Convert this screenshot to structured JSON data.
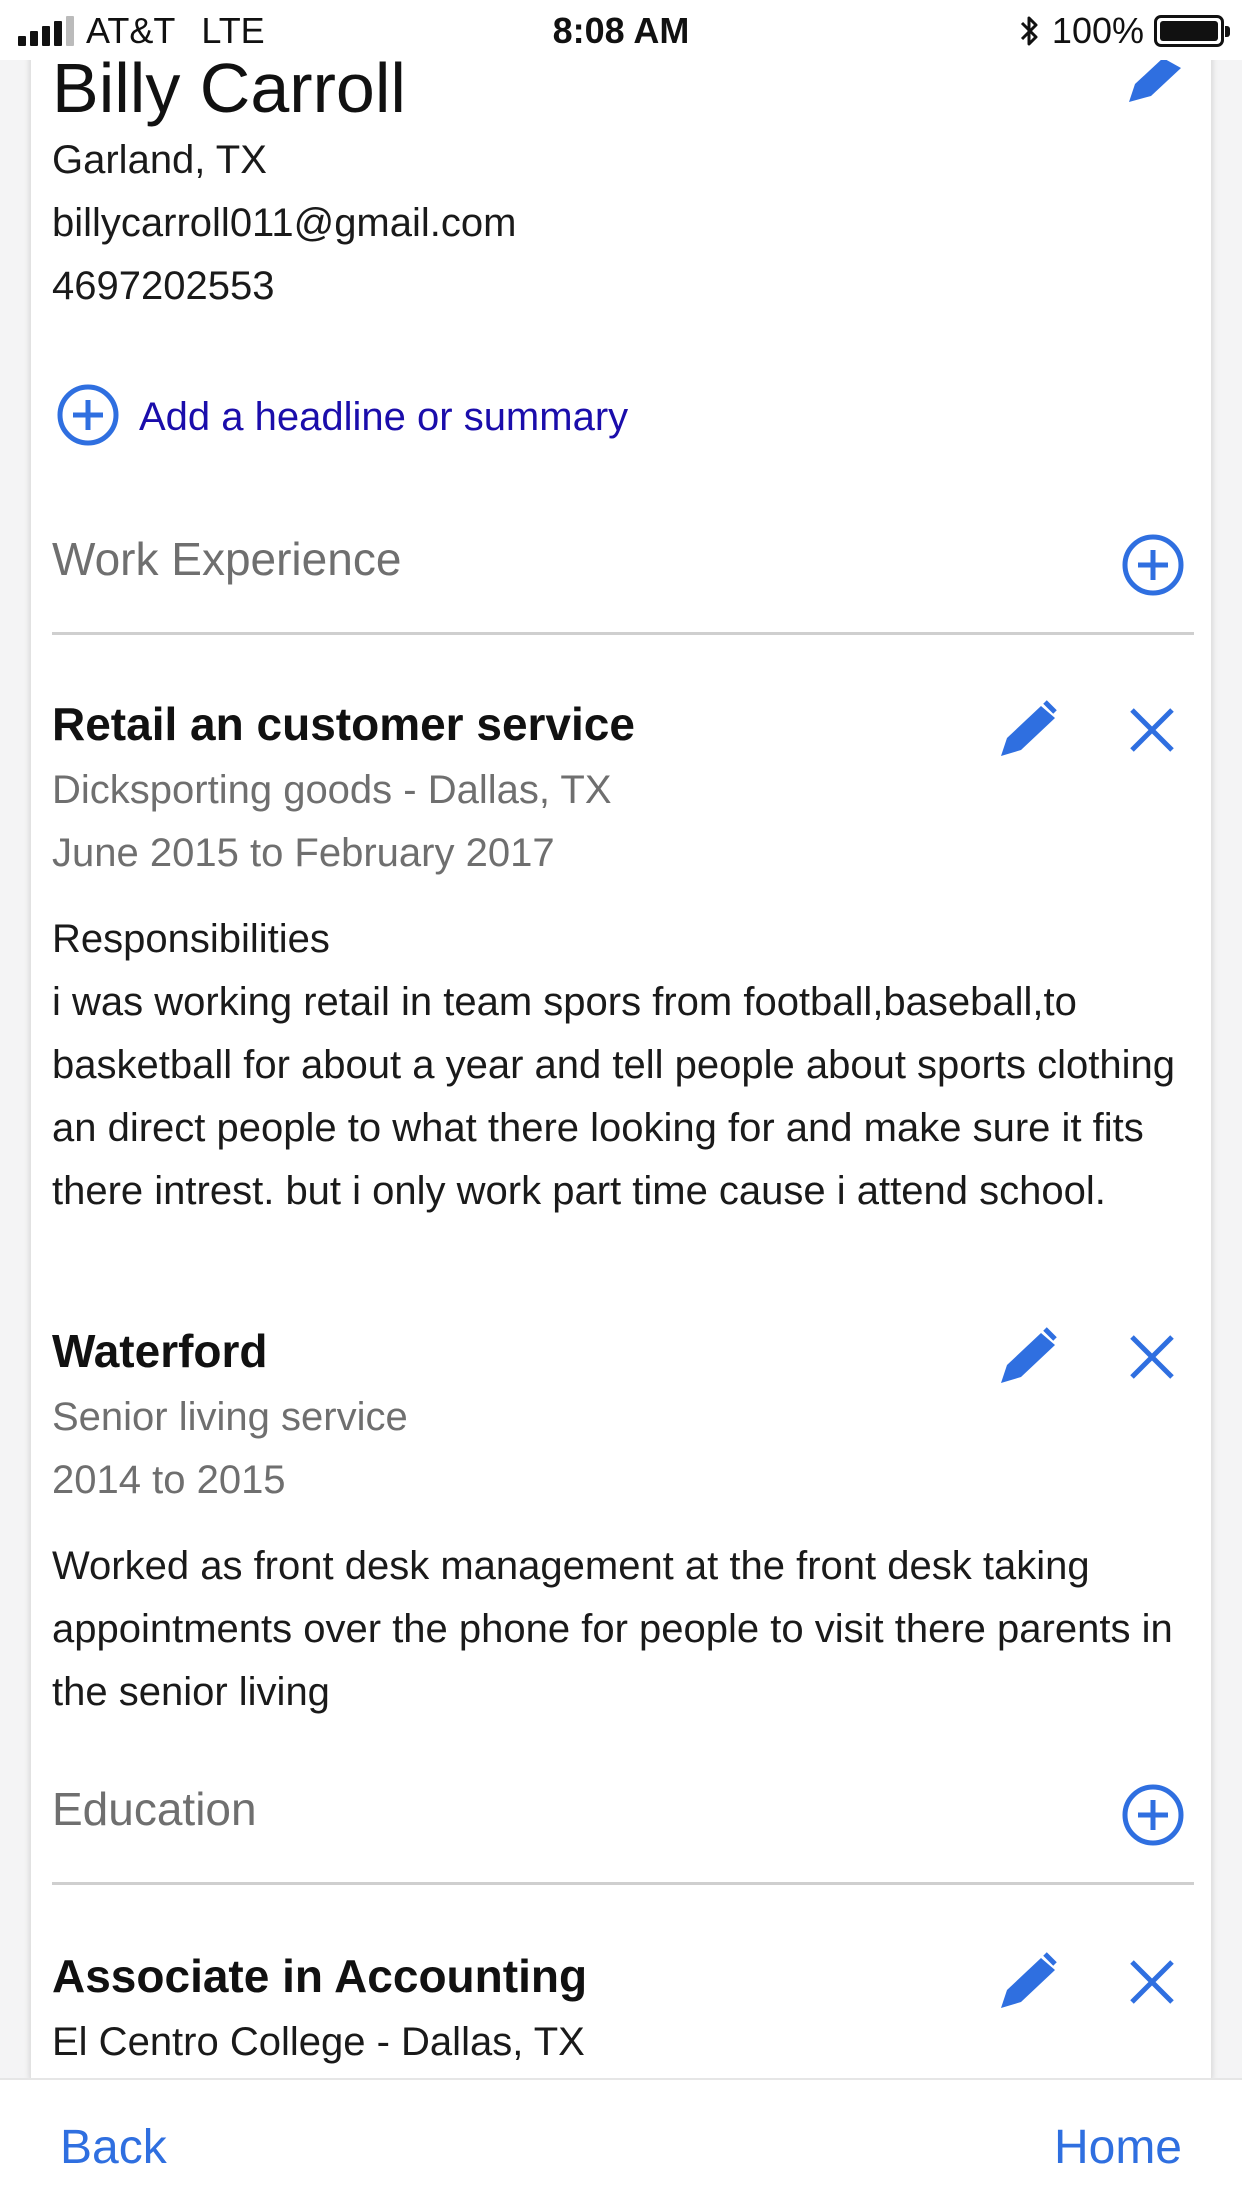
{
  "status_bar": {
    "carrier": "AT&T",
    "network": "LTE",
    "time": "8:08 AM",
    "battery": "100%",
    "bluetooth_icon": "bluetooth-icon"
  },
  "profile": {
    "name": "Billy Carroll",
    "location": "Garland, TX",
    "email": "billycarroll011@gmail.com",
    "phone": "4697202553",
    "add_headline_label": "Add a headline or summary"
  },
  "work_experience": {
    "title": "Work Experience",
    "jobs": [
      {
        "title": "Retail an customer service",
        "company": "Dicksporting goods - Dallas, TX",
        "dates": "June 2015 to February 2017",
        "description_heading": "Responsibilities",
        "description": "i was working retail in team spors from football,baseball,to basketball for about a year and tell people about sports clothing an direct people to what there looking for and make sure it fits there intrest. but i only work part time cause i attend school."
      },
      {
        "title": "Waterford",
        "company": "Senior living service",
        "dates": "2014 to 2015",
        "description": "Worked as front desk management at the front desk taking appointments over the phone for people to visit there parents in the senior living"
      }
    ]
  },
  "education": {
    "title": "Education",
    "items": [
      {
        "degree": "Associate in Accounting",
        "school": "El Centro College - Dallas, TX"
      }
    ]
  },
  "bottom_nav": {
    "back_label": "Back",
    "home_label": "Home"
  },
  "colors": {
    "accent": "#2f6fe0",
    "link": "#1a0dab",
    "muted_text": "#6f6f6f"
  }
}
